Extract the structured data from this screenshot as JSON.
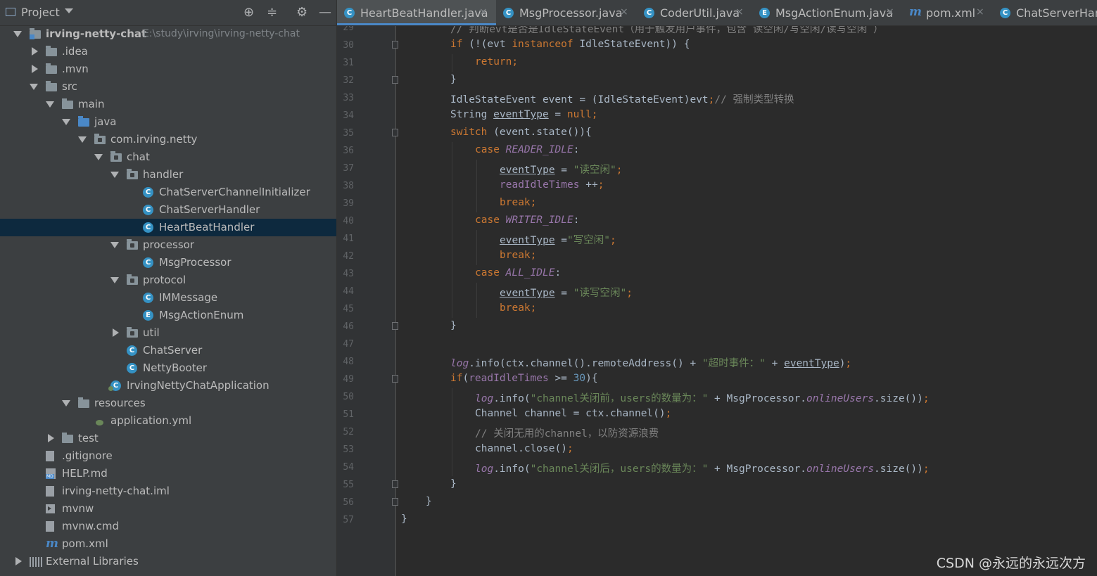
{
  "project_panel": {
    "title": "Project",
    "tree": [
      {
        "label": "irving-netty-chat",
        "path": "E:\\study\\irving\\irving-netty-chat",
        "icon": "module-folder-icon",
        "depth": 0,
        "expand": "open",
        "bold": true
      },
      {
        "label": ".idea",
        "icon": "folder-icon",
        "depth": 1,
        "expand": "closed"
      },
      {
        "label": ".mvn",
        "icon": "folder-icon",
        "depth": 1,
        "expand": "closed"
      },
      {
        "label": "src",
        "icon": "folder-icon",
        "depth": 1,
        "expand": "open"
      },
      {
        "label": "main",
        "icon": "folder-icon",
        "depth": 2,
        "expand": "open"
      },
      {
        "label": "java",
        "icon": "source-folder-icon",
        "depth": 3,
        "expand": "open"
      },
      {
        "label": "com.irving.netty",
        "icon": "package-icon",
        "depth": 4,
        "expand": "open"
      },
      {
        "label": "chat",
        "icon": "package-icon",
        "depth": 5,
        "expand": "open"
      },
      {
        "label": "handler",
        "icon": "package-icon",
        "depth": 6,
        "expand": "open"
      },
      {
        "label": "ChatServerChannelInitializer",
        "icon": "class-icon",
        "depth": 7
      },
      {
        "label": "ChatServerHandler",
        "icon": "class-icon",
        "depth": 7
      },
      {
        "label": "HeartBeatHandler",
        "icon": "class-icon",
        "depth": 7,
        "selected": true
      },
      {
        "label": "processor",
        "icon": "package-icon",
        "depth": 6,
        "expand": "open"
      },
      {
        "label": "MsgProcessor",
        "icon": "class-icon",
        "depth": 7
      },
      {
        "label": "protocol",
        "icon": "package-icon",
        "depth": 6,
        "expand": "open"
      },
      {
        "label": "IMMessage",
        "icon": "class-icon",
        "depth": 7
      },
      {
        "label": "MsgActionEnum",
        "icon": "enum-icon",
        "depth": 7
      },
      {
        "label": "util",
        "icon": "package-icon",
        "depth": 6,
        "expand": "closed"
      },
      {
        "label": "ChatServer",
        "icon": "class-icon",
        "depth": 6
      },
      {
        "label": "NettyBooter",
        "icon": "class-icon",
        "depth": 6
      },
      {
        "label": "IrvingNettyChatApplication",
        "icon": "spring-app-icon",
        "depth": 5
      },
      {
        "label": "resources",
        "icon": "resources-folder-icon",
        "depth": 3,
        "expand": "open"
      },
      {
        "label": "application.yml",
        "icon": "yaml-file-icon",
        "depth": 4
      },
      {
        "label": "test",
        "icon": "folder-icon",
        "depth": 2,
        "expand": "closed"
      },
      {
        "label": ".gitignore",
        "icon": "text-file-icon",
        "depth": 1
      },
      {
        "label": "HELP.md",
        "icon": "markdown-file-icon",
        "depth": 1
      },
      {
        "label": "irving-netty-chat.iml",
        "icon": "text-file-icon",
        "depth": 1
      },
      {
        "label": "mvnw",
        "icon": "terminal-file-icon",
        "depth": 1
      },
      {
        "label": "mvnw.cmd",
        "icon": "text-file-icon",
        "depth": 1
      },
      {
        "label": "pom.xml",
        "icon": "maven-icon",
        "depth": 1
      },
      {
        "label": "External Libraries",
        "icon": "libraries-icon",
        "depth": 0,
        "expand": "closed"
      }
    ]
  },
  "tabs": [
    {
      "label": "HeartBeatHandler.java",
      "icon": "C",
      "active": true
    },
    {
      "label": "MsgProcessor.java",
      "icon": "C"
    },
    {
      "label": "CoderUtil.java",
      "icon": "C"
    },
    {
      "label": "MsgActionEnum.java",
      "icon": "E"
    },
    {
      "label": "pom.xml",
      "icon": "m"
    },
    {
      "label": "ChatServerHand",
      "icon": "C"
    }
  ],
  "code_lines": [
    {
      "n": "29",
      "indent": 2,
      "segs": [
        [
          "cm",
          "// 判断evt是否是IdleStateEvent（用于触发用户事件，包含 读空闲/写空闲/读写空闲 ）"
        ]
      ]
    },
    {
      "n": "30",
      "indent": 2,
      "fold": true,
      "segs": [
        [
          "kw",
          "if "
        ],
        [
          "",
          "(!(evt "
        ],
        [
          "kw",
          "instanceof "
        ],
        [
          "",
          "IdleStateEvent)) {"
        ]
      ]
    },
    {
      "n": "31",
      "indent": 3,
      "segs": [
        [
          "kw",
          "return;"
        ]
      ]
    },
    {
      "n": "32",
      "indent": 2,
      "fold": true,
      "segs": [
        [
          "",
          "}"
        ]
      ]
    },
    {
      "n": "33",
      "indent": 2,
      "segs": [
        [
          "",
          "IdleStateEvent event = (IdleStateEvent)evt"
        ],
        [
          "kw",
          ";"
        ],
        [
          "cm",
          "// 强制类型转换"
        ]
      ]
    },
    {
      "n": "34",
      "indent": 2,
      "segs": [
        [
          "",
          "String "
        ],
        [
          "ul",
          "eventType"
        ],
        [
          "",
          " = "
        ],
        [
          "kw",
          "null;"
        ]
      ]
    },
    {
      "n": "35",
      "indent": 2,
      "fold": true,
      "segs": [
        [
          "kw",
          "switch "
        ],
        [
          "",
          "(event.state()){"
        ]
      ]
    },
    {
      "n": "36",
      "indent": 3,
      "segs": [
        [
          "kw",
          "case "
        ],
        [
          "sfld",
          "READER_IDLE"
        ],
        [
          "",
          ":"
        ]
      ]
    },
    {
      "n": "37",
      "indent": 4,
      "segs": [
        [
          "ul",
          "eventType"
        ],
        [
          "",
          " = "
        ],
        [
          "st",
          "\"读空闲\""
        ],
        [
          "kw",
          ";"
        ]
      ]
    },
    {
      "n": "38",
      "indent": 4,
      "segs": [
        [
          "fld",
          "readIdleTimes "
        ],
        [
          "",
          "++"
        ],
        [
          "kw",
          ";"
        ]
      ]
    },
    {
      "n": "39",
      "indent": 4,
      "segs": [
        [
          "kw",
          "break;"
        ]
      ]
    },
    {
      "n": "40",
      "indent": 3,
      "segs": [
        [
          "kw",
          "case "
        ],
        [
          "sfld",
          "WRITER_IDLE"
        ],
        [
          "",
          ":"
        ]
      ]
    },
    {
      "n": "41",
      "indent": 4,
      "segs": [
        [
          "ul",
          "eventType"
        ],
        [
          "",
          " ="
        ],
        [
          "st",
          "\"写空闲\""
        ],
        [
          "kw",
          ";"
        ]
      ]
    },
    {
      "n": "42",
      "indent": 4,
      "segs": [
        [
          "kw",
          "break;"
        ]
      ]
    },
    {
      "n": "43",
      "indent": 3,
      "segs": [
        [
          "kw",
          "case "
        ],
        [
          "sfld",
          "ALL_IDLE"
        ],
        [
          "",
          ":"
        ]
      ]
    },
    {
      "n": "44",
      "indent": 4,
      "segs": [
        [
          "ul",
          "eventType"
        ],
        [
          "",
          " = "
        ],
        [
          "st",
          "\"读写空闲\""
        ],
        [
          "kw",
          ";"
        ]
      ]
    },
    {
      "n": "45",
      "indent": 4,
      "segs": [
        [
          "kw",
          "break;"
        ]
      ]
    },
    {
      "n": "46",
      "indent": 2,
      "fold": true,
      "segs": [
        [
          "",
          "}"
        ]
      ]
    },
    {
      "n": "47",
      "indent": 0,
      "segs": []
    },
    {
      "n": "48",
      "indent": 2,
      "segs": [
        [
          "sfld",
          "log"
        ],
        [
          "",
          ".info(ctx.channel().remoteAddress() + "
        ],
        [
          "st",
          "\"超时事件：\" "
        ],
        [
          "",
          "+ "
        ],
        [
          "ul",
          "eventType"
        ],
        [
          "",
          ")"
        ],
        [
          "kw",
          ";"
        ]
      ]
    },
    {
      "n": "49",
      "indent": 2,
      "fold": true,
      "segs": [
        [
          "kw",
          "if"
        ],
        [
          "",
          "("
        ],
        [
          "fld",
          "readIdleTimes "
        ],
        [
          "",
          ">= "
        ],
        [
          "nu",
          "30"
        ],
        [
          "",
          "){"
        ]
      ]
    },
    {
      "n": "50",
      "indent": 3,
      "segs": [
        [
          "sfld",
          "log"
        ],
        [
          "",
          ".info("
        ],
        [
          "st",
          "\"channel关闭前，users的数量为：\" "
        ],
        [
          "",
          "+ MsgProcessor."
        ],
        [
          "sfld",
          "onlineUsers"
        ],
        [
          "",
          ".size())"
        ],
        [
          "kw",
          ";"
        ]
      ]
    },
    {
      "n": "51",
      "indent": 3,
      "segs": [
        [
          "",
          "Channel channel = ctx.channel()"
        ],
        [
          "kw",
          ";"
        ]
      ]
    },
    {
      "n": "52",
      "indent": 3,
      "segs": [
        [
          "cm",
          "// 关闭无用的channel，以防资源浪费"
        ]
      ]
    },
    {
      "n": "53",
      "indent": 3,
      "segs": [
        [
          "",
          "channel.close()"
        ],
        [
          "kw",
          ";"
        ]
      ]
    },
    {
      "n": "54",
      "indent": 3,
      "segs": [
        [
          "sfld",
          "log"
        ],
        [
          "",
          ".info("
        ],
        [
          "st",
          "\"channel关闭后，users的数量为：\" "
        ],
        [
          "",
          "+ MsgProcessor."
        ],
        [
          "sfld",
          "onlineUsers"
        ],
        [
          "",
          ".size())"
        ],
        [
          "kw",
          ";"
        ]
      ]
    },
    {
      "n": "55",
      "indent": 2,
      "fold": true,
      "segs": [
        [
          "",
          "}"
        ]
      ]
    },
    {
      "n": "56",
      "indent": 1,
      "fold": true,
      "segs": [
        [
          "",
          "}"
        ]
      ]
    },
    {
      "n": "57",
      "indent": 0,
      "segs": [
        [
          "",
          "}"
        ]
      ]
    }
  ],
  "watermark": "CSDN @永远的永远次方",
  "colors": {
    "keyword": "#cc7832",
    "string": "#6a8759",
    "comment": "#808080",
    "number": "#6897bb",
    "field": "#9876aa",
    "text": "#a9b7c6",
    "selection": "#0d293e",
    "accent": "#4a88c7"
  }
}
